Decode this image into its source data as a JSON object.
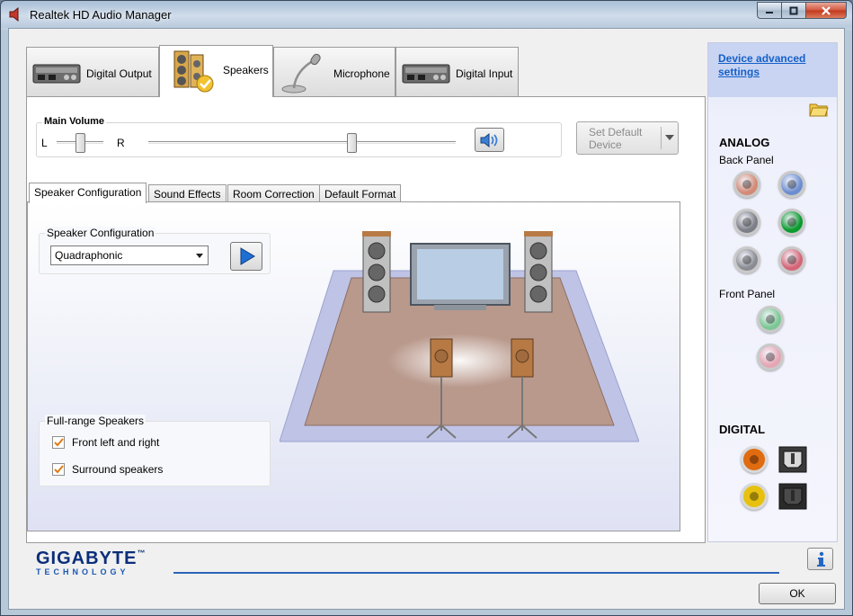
{
  "window": {
    "title": "Realtek HD Audio Manager",
    "controls": [
      "minimize",
      "maximize",
      "close"
    ]
  },
  "device_tabs": [
    {
      "label": "Digital Output",
      "active": false,
      "icon": "digital-output-icon"
    },
    {
      "label": "Speakers",
      "active": true,
      "icon": "speakers-icon"
    },
    {
      "label": "Microphone",
      "active": false,
      "icon": "microphone-icon"
    },
    {
      "label": "Digital Input",
      "active": false,
      "icon": "digital-input-icon"
    }
  ],
  "main_volume": {
    "title": "Main Volume",
    "left_label": "L",
    "right_label": "R",
    "balance": 0.5,
    "volume": 0.66
  },
  "set_default_device": {
    "label_line1": "Set Default",
    "label_line2": "Device"
  },
  "sub_tabs": [
    {
      "label": "Speaker Configuration",
      "active": true
    },
    {
      "label": "Sound Effects",
      "active": false
    },
    {
      "label": "Room Correction",
      "active": false
    },
    {
      "label": "Default Format",
      "active": false
    }
  ],
  "speaker_configuration": {
    "group_title": "Speaker Configuration",
    "selected": "Quadraphonic"
  },
  "full_range_speakers": {
    "group_title": "Full-range Speakers",
    "options": [
      {
        "label": "Front left and right",
        "checked": true
      },
      {
        "label": "Surround speakers",
        "checked": true
      }
    ]
  },
  "right_panel": {
    "advanced_link": "Device advanced settings",
    "analog_heading": "ANALOG",
    "back_panel_label": "Back Panel",
    "front_panel_label": "Front Panel",
    "digital_heading": "DIGITAL",
    "back_jacks": [
      "#d28a76",
      "#6c8ed0",
      "#7b7e86",
      "#0a9a2e",
      "#8a8c94",
      "#d46577"
    ],
    "front_jacks": [
      "#7cc795",
      "#e5a6b4"
    ],
    "digital_jacks": [
      "#e06b10",
      "#e7c10e"
    ]
  },
  "brand": {
    "name": "GIGABYTE",
    "trademark": "™",
    "sub": "TECHNOLOGY"
  },
  "buttons": {
    "ok": "OK"
  }
}
